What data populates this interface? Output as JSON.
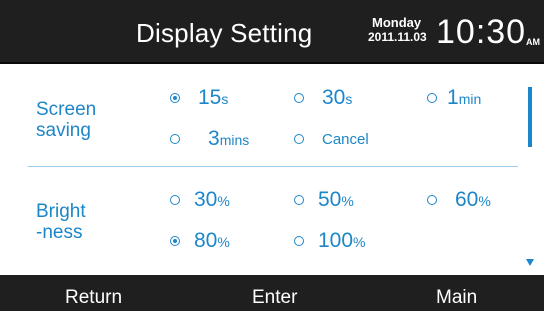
{
  "header": {
    "title": "Display Setting",
    "day": "Monday",
    "date": "2011.11.03",
    "time": "10:30",
    "ampm": "AM"
  },
  "screen_saving": {
    "label_line1": "Screen",
    "label_line2": "saving",
    "options": [
      {
        "value": "15",
        "unit": "s",
        "selected": true
      },
      {
        "value": "30",
        "unit": "s",
        "selected": false
      },
      {
        "value": "1",
        "unit": "min",
        "selected": false
      },
      {
        "value": "3",
        "unit": "mins",
        "selected": false
      },
      {
        "value": "Cancel",
        "unit": "",
        "selected": false
      }
    ]
  },
  "brightness": {
    "label_line1": "Bright",
    "label_line2": "-ness",
    "options": [
      {
        "value": "30",
        "unit": "%",
        "selected": false
      },
      {
        "value": "50",
        "unit": "%",
        "selected": false
      },
      {
        "value": "60",
        "unit": "%",
        "selected": false
      },
      {
        "value": "80",
        "unit": "%",
        "selected": true
      },
      {
        "value": "100",
        "unit": "%",
        "selected": false
      }
    ]
  },
  "footer": {
    "return_label": "Return",
    "enter_label": "Enter",
    "main_label": "Main"
  },
  "colors": {
    "accent": "#1d86c9",
    "bar_background": "#1f1f1f"
  },
  "icons": {
    "scroll_down": "triangle-down-icon"
  }
}
